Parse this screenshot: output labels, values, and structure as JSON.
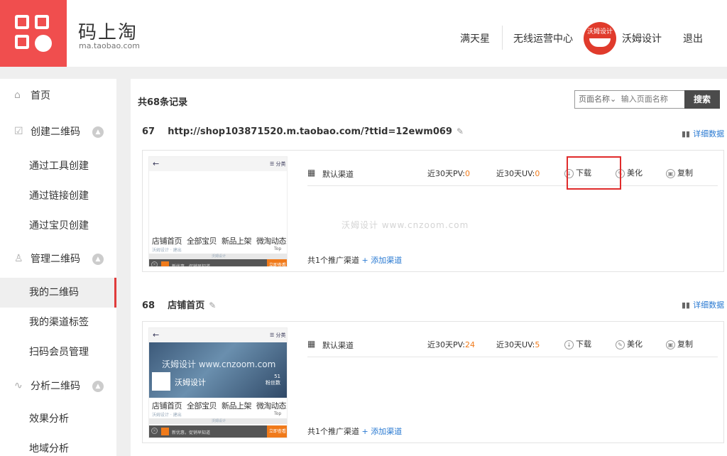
{
  "header": {
    "logo_title": "码上淘",
    "logo_sub": "ma.taobao.com",
    "nav": [
      "满天星",
      "无线运营中心"
    ],
    "avatar_text": "沃姆设计",
    "user_name": "沃姆设计",
    "logout": "退出"
  },
  "sidebar": {
    "home": "首页",
    "create": "创建二维码",
    "create_items": [
      "通过工具创建",
      "通过链接创建",
      "通过宝贝创建"
    ],
    "manage": "管理二维码",
    "manage_items": [
      "我的二维码",
      "我的渠道标签",
      "扫码会员管理"
    ],
    "analyze": "分析二维码",
    "analyze_items": [
      "效果分析",
      "地域分析"
    ]
  },
  "main": {
    "records": "共68条记录",
    "search": {
      "select": "页面名称",
      "placeholder": "输入页面名称",
      "button": "搜索"
    },
    "detail": "详细数据",
    "records_list": [
      {
        "id": "67",
        "title": "http://shop103871520.m.taobao.com/?ttid=12ewm069",
        "channel": "默认渠道",
        "pv_label": "近30天PV:",
        "pv": "0",
        "uv_label": "近30天UV:",
        "uv": "0",
        "actions": [
          "下载",
          "美化",
          "复制"
        ],
        "footer_count": "共1个推广渠道",
        "footer_add": "+ 添加渠道"
      },
      {
        "id": "68",
        "title": "店铺首页",
        "channel": "默认渠道",
        "pv_label": "近30天PV:",
        "pv": "24",
        "uv_label": "近30天UV:",
        "uv": "5",
        "actions": [
          "下载",
          "美化",
          "复制"
        ],
        "footer_count": "共1个推广渠道",
        "footer_add": "+ 添加渠道"
      }
    ],
    "watermark": "沃姆设计 www.cnzoom.com",
    "thumb": {
      "back": "←",
      "category": "分类",
      "tabs": [
        "店铺首页",
        "全部宝贝",
        "新品上架",
        "微淘动态"
      ],
      "sub": "沃姆设计 · 建出",
      "top": "Top",
      "grey": "沃姆设计",
      "foot_text": "新优惠，促销早知道",
      "foot_btn": "立即查看",
      "banner_wm": "沃姆设计 www.cnzoom.com",
      "shop_name": "沃姆设计",
      "fans_num": "51",
      "fans_label": "粉丝数"
    }
  }
}
